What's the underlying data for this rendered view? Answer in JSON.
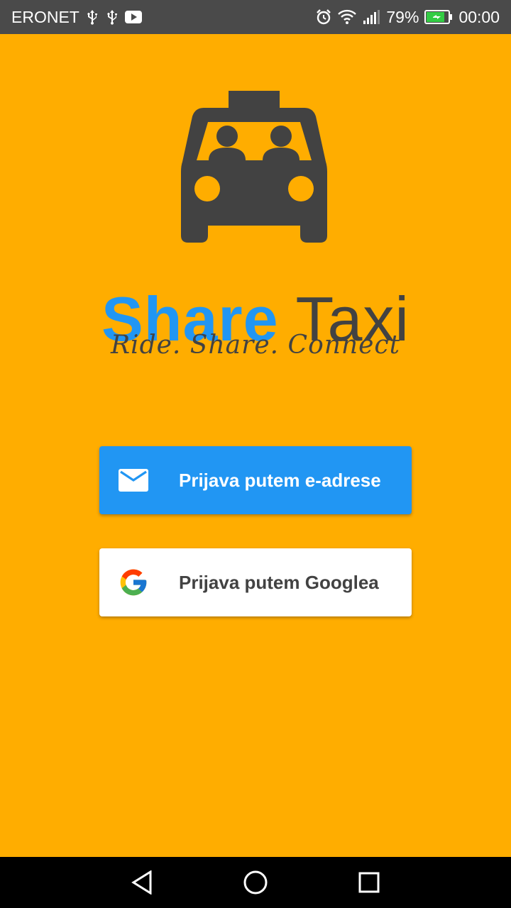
{
  "status_bar": {
    "carrier": "ERONET",
    "battery_percent": "79%",
    "time": "00:00",
    "icons_left": [
      "usb-icon",
      "usb-icon",
      "youtube-icon"
    ],
    "icons_right": [
      "alarm-icon",
      "wifi-icon",
      "signal-icon",
      "battery-charging-icon"
    ]
  },
  "brand": {
    "name_part1": "Share",
    "name_part2": "Taxi",
    "tagline": "Ride. Share. Connect",
    "logo_icon": "taxi-icon",
    "colors": {
      "background": "#FFAD00",
      "share": "#2196F3",
      "taxi": "#424242"
    }
  },
  "buttons": {
    "email": {
      "label": "Prijava putem e-adrese",
      "icon": "mail-icon",
      "color": "#2196F3"
    },
    "google": {
      "label": "Prijava putem Googlea",
      "icon": "google-icon",
      "color": "#FFFFFF"
    }
  },
  "nav_bar": {
    "icons": [
      "back-icon",
      "home-icon",
      "recents-icon"
    ]
  }
}
